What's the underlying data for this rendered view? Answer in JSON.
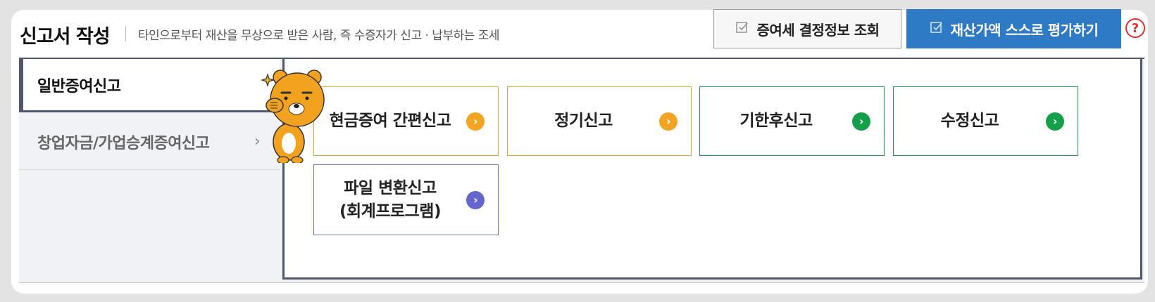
{
  "header": {
    "title": "신고서 작성",
    "description": "타인으로부터 재산을 무상으로 받은 사람, 즉 수증자가 신고 · 납부하는 조세",
    "lookup_button": "증여세 결정정보 조회",
    "assess_button": "재산가액 스스로 평가하기",
    "help_symbol": "?"
  },
  "menu": {
    "items": [
      {
        "label": "일반증여신고",
        "active": true
      },
      {
        "label": "창업자금/가업승계증여신고",
        "chevron": "›"
      }
    ]
  },
  "options": [
    {
      "label": "현금증여 간편신고",
      "arrow": "›",
      "color": "orange"
    },
    {
      "label": "정기신고",
      "arrow": "›",
      "color": "orange"
    },
    {
      "label": "기한후신고",
      "arrow": "›",
      "color": "green"
    },
    {
      "label": "수정신고",
      "arrow": "›",
      "color": "green"
    },
    {
      "label_line1": "파일 변환신고",
      "label_line2": "(회계프로그램)",
      "arrow": "›",
      "color": "purple"
    }
  ],
  "colors": {
    "primary_blue": "#2e7ac4",
    "navy_border": "#4e586c",
    "orange": "#f3a423",
    "green": "#14a04a",
    "purple": "#6366cd",
    "help_red": "#e0312a"
  },
  "icons": {
    "button_check": "check-square-icon",
    "help": "help-circle-icon",
    "option_arrow": "chevron-right-circle-icon",
    "mascot": "mascot-character-icon"
  }
}
